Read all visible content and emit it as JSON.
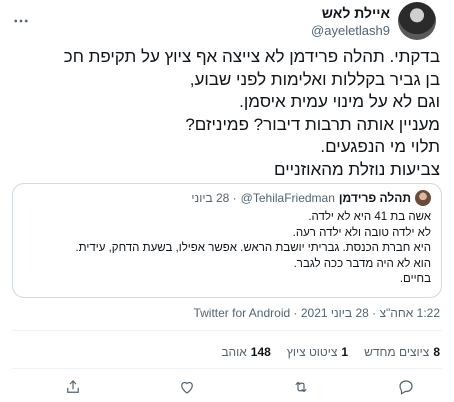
{
  "author": {
    "display_name": "איילת לאש",
    "handle": "@ayeletlash9"
  },
  "tweet_lines": [
    "בדקתי. תהלה פרידמן לא צייצה אף ציוץ על תקיפת חכ",
    "בן גביר בקללות ואלימות לפני שבוע,",
    "וגם לא על מינוי עמית איסמן.",
    "מעניין אותה תרבות דיבור? פמיניזם?",
    "תלוי מי הנפגעים.",
    "צביעות נוזלת מהאוזניים"
  ],
  "quote": {
    "name": "תהלה פרידמן",
    "handle": "@TehilaFriedman",
    "date": "· 28 ביוני",
    "lines": [
      "אשה בת 41 היא לא ילדה.",
      "לא ילדה טובה ולא ילדה רעה.",
      "היא חברת הכנסת. גבריתי יושבת הראש. אפשר אפילו, בשעת הדחק, עידית.",
      "הוא לא היה מדבר ככה לגבר.",
      "בחיים."
    ]
  },
  "meta": {
    "time_date": "1:22 אחה\"צ · 28 ביוני 2021 ·",
    "app": "Twitter for Android"
  },
  "stats": {
    "retweets_count": "8",
    "retweets_label": "ציוצים מחדש",
    "quotes_count": "1",
    "quotes_label": "ציטוט ציוץ",
    "likes_count": "148",
    "likes_label": "אוהב"
  },
  "icons": {
    "more": "more-options-icon",
    "reply": "reply-icon",
    "retweet": "retweet-icon",
    "like": "heart-icon",
    "share": "share-icon"
  },
  "colors": {
    "text": "#0f1419",
    "secondary": "#536471",
    "border": "#cfd9de"
  }
}
